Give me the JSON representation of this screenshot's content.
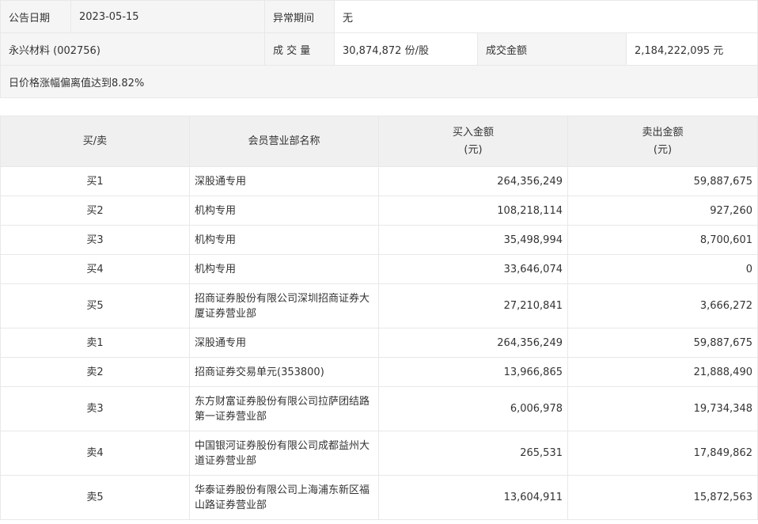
{
  "header": {
    "date_label": "公告日期",
    "date_value": "2023-05-15",
    "period_label": "异常期间",
    "period_value": "无",
    "stock": "永兴材料 (002756)",
    "volume_label": "成 交 量",
    "volume_value": "30,874,872 份/股",
    "amount_label": "成交金额",
    "amount_value": "2,184,222,095 元",
    "reason": "日价格涨幅偏离值达到8.82%"
  },
  "table": {
    "columns": [
      "买/卖",
      "会员营业部名称",
      "买入金额",
      "(元)",
      "卖出金额",
      "(元)"
    ],
    "rows": [
      {
        "side": "买1",
        "name": "深股通专用",
        "buy": "264,356,249",
        "sell": "59,887,675"
      },
      {
        "side": "买2",
        "name": "机构专用",
        "buy": "108,218,114",
        "sell": "927,260"
      },
      {
        "side": "买3",
        "name": "机构专用",
        "buy": "35,498,994",
        "sell": "8,700,601"
      },
      {
        "side": "买4",
        "name": "机构专用",
        "buy": "33,646,074",
        "sell": "0"
      },
      {
        "side": "买5",
        "name": "招商证券股份有限公司深圳招商证券大厦证券营业部",
        "buy": "27,210,841",
        "sell": "3,666,272"
      },
      {
        "side": "卖1",
        "name": "深股通专用",
        "buy": "264,356,249",
        "sell": "59,887,675"
      },
      {
        "side": "卖2",
        "name": "招商证券交易单元(353800)",
        "buy": "13,966,865",
        "sell": "21,888,490"
      },
      {
        "side": "卖3",
        "name": "东方财富证券股份有限公司拉萨团结路第一证券营业部",
        "buy": "6,006,978",
        "sell": "19,734,348"
      },
      {
        "side": "卖4",
        "name": "中国银河证券股份有限公司成都益州大道证券营业部",
        "buy": "265,531",
        "sell": "17,849,862"
      },
      {
        "side": "卖5",
        "name": "华泰证券股份有限公司上海浦东新区福山路证券营业部",
        "buy": "13,604,911",
        "sell": "15,872,563"
      }
    ]
  }
}
